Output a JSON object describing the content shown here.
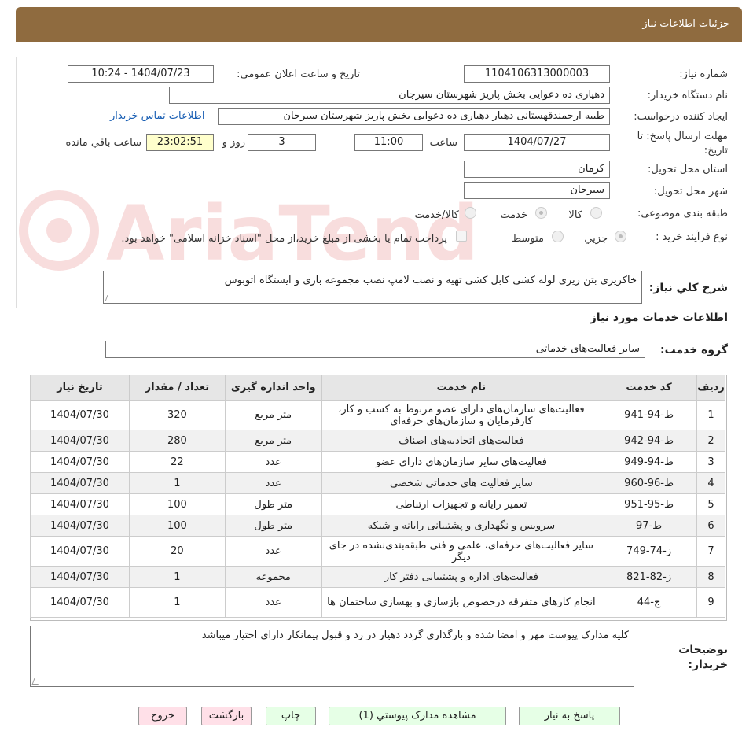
{
  "header": {
    "title": "جزئیات اطلاعات نیاز"
  },
  "form": {
    "need_number_label": "شماره نياز:",
    "need_number": "1104106313000003",
    "announce_label": "تاريخ و ساعت اعلان عمومي:",
    "announce_value": "1404/07/23 - 10:24",
    "buyer_label": "نام دستگاه خريدار:",
    "buyer_value": "دهياری ده دعوايی بخش پاريز شهرستان سيرجان",
    "creator_label": "ايجاد کننده درخواست:",
    "creator_value": "طيبه ارجمندقهستانی دهيار دهياری ده دعوايی بخش پاريز شهرستان سيرجان",
    "contact_link": "اطلاعات تماس خريدار",
    "deadline_label": "مهلت ارسال پاسخ: تا تاريخ:",
    "deadline_date": "1404/07/27",
    "time_label": "ساعت",
    "deadline_time": "11:00",
    "days_value": "3",
    "days_label": "روز و",
    "remaining_time": "23:02:51",
    "remaining_label": "ساعت باقي مانده",
    "province_label": "استان محل تحويل:",
    "province_value": "کرمان",
    "city_label": "شهر محل تحويل:",
    "city_value": "سيرجان",
    "category_label": "طبقه بندی موضوعی:",
    "category_options": [
      "کالا",
      "خدمت",
      "کالا/خدمت"
    ],
    "process_label": "نوع فرآيند خريد :",
    "process_options": [
      "جزيي",
      "متوسط"
    ],
    "payment_note": "پرداخت تمام يا بخشی از مبلغ خريد،از محل \"اسناد خزانه اسلامی\" خواهد بود.",
    "summary_label": "شرح کلي نياز:",
    "summary_value": "خاکریزی بتن ریزی لوله کشی کابل کشی تهیه و نصب لامپ نصب مجموعه بازی و ایستگاه اتوبوس",
    "services_title": "اطلاعات خدمات مورد نياز",
    "service_group_label": "گروه خدمت:",
    "service_group_value": "ساير فعاليت‌های خدماتی"
  },
  "table": {
    "headers": [
      "رديف",
      "کد خدمت",
      "نام خدمت",
      "واحد اندازه گيری",
      "تعداد / مقدار",
      "تاريخ نياز"
    ],
    "rows": [
      [
        "1",
        "ط-94-941",
        "فعاليت‌های سازمان‌های دارای عضو مربوط به کسب و کار، کارفرمايان و سازمان‌های حرفه‌ای",
        "متر مربع",
        "320",
        "1404/07/30"
      ],
      [
        "2",
        "ط-94-942",
        "فعاليت‌های اتحاديه‌های اصناف",
        "متر مربع",
        "280",
        "1404/07/30"
      ],
      [
        "3",
        "ط-94-949",
        "فعاليت‌های ساير سازمان‌های دارای عضو",
        "عدد",
        "22",
        "1404/07/30"
      ],
      [
        "4",
        "ط-96-960",
        "ساير فعاليت های خدماتی شخصی",
        "عدد",
        "1",
        "1404/07/30"
      ],
      [
        "5",
        "ط-95-951",
        "تعمير رايانه و تجهيزات ارتباطی",
        "متر طول",
        "100",
        "1404/07/30"
      ],
      [
        "6",
        "ط-97",
        "سرويس و نگهداری و پشتيبانی رايانه و شبکه",
        "متر طول",
        "100",
        "1404/07/30"
      ],
      [
        "7",
        "ز-74-749",
        "ساير فعاليت‌های حرفه‌ای، علمی و فنی طبقه‌بندی‌نشده در جای ديگر",
        "عدد",
        "20",
        "1404/07/30"
      ],
      [
        "8",
        "ز-82-821",
        "فعاليت‌های اداره و پشتيبانی دفتر کار",
        "مجموعه",
        "1",
        "1404/07/30"
      ],
      [
        "9",
        "ج-44",
        "انجام کارهای متفرقه درخصوص بازسازی و بهسازی ساختمان ها",
        "عدد",
        "1",
        "1404/07/30"
      ]
    ]
  },
  "notes": {
    "label": "توضيحات خريدار:",
    "value": "کليه مدارک پيوست مهر و امضا شده و بارگذاری گردد دهيار در رد و قبول پيمانکار دارای اختيار ميباشد"
  },
  "buttons": {
    "reply": "پاسخ به نياز",
    "attachments": "مشاهده مدارک پيوستي (1)",
    "print": "چاپ",
    "back": "بازگشت",
    "exit": "خروج"
  },
  "watermark": {
    "text": "AriaTender.neT"
  },
  "colors": {
    "header_bg": "#8f6b3f",
    "link": "#1a5fb4",
    "button_green": "#e6ffe6",
    "button_pink": "#ffe0e8",
    "time_bg": "#ffffcc"
  }
}
